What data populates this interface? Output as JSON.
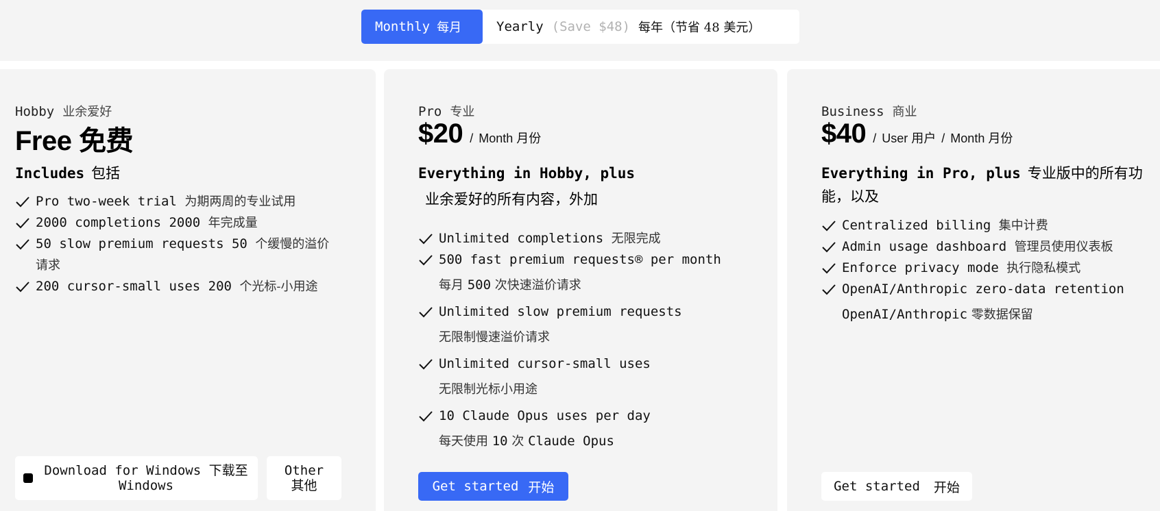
{
  "toggle": {
    "monthly_label": "Monthly",
    "monthly_cn": "每月",
    "yearly_label": "Yearly",
    "yearly_save": "(Save $48)",
    "yearly_cn": "每年（节省 48 美元）"
  },
  "hobby": {
    "name": "Hobby",
    "name_cn": "业余爱好",
    "price": "Free 免费",
    "heading": "Includes",
    "heading_cn": "包括",
    "features": [
      {
        "en": "Pro two-week trial",
        "cn": "为期两周的专业试用"
      },
      {
        "en": "2000 completions 2000",
        "cn": "年完成量"
      },
      {
        "en": "50 slow premium requests 50",
        "cn": "个缓慢的溢价请求"
      },
      {
        "en": "200 cursor-small uses 200",
        "cn": "个光标-小用途"
      }
    ],
    "download_label": "Download for Windows",
    "download_cn": "下载至",
    "download_tail": "Windows",
    "other_label": "Other",
    "other_cn": "其他"
  },
  "pro": {
    "name": "Pro",
    "name_cn": "专业",
    "price": "$20",
    "unit_sep": "/",
    "unit": "Month 月份",
    "heading": "Everything in Hobby, plus",
    "heading_cn": "业余爱好的所有内容，外加",
    "features": [
      {
        "en": "Unlimited completions",
        "cn": "无限完成",
        "sub": ""
      },
      {
        "en": "500 fast premium requests® per month",
        "cn": "",
        "sub_a": "每月",
        "sub_m": "500",
        "sub_b": "次快速溢价请求"
      },
      {
        "en": "Unlimited slow premium requests",
        "cn": "",
        "sub": "无限制慢速溢价请求"
      },
      {
        "en": "Unlimited cursor-small uses",
        "cn": "",
        "sub": "无限制光标小用途"
      },
      {
        "en": "10 Claude Opus uses per day",
        "cn": "",
        "sub_a": "每天使用",
        "sub_m": "10",
        "sub_b": "次",
        "sub_m2": "Claude Opus"
      }
    ],
    "cta": "Get started",
    "cta_cn": "开始"
  },
  "business": {
    "name": "Business",
    "name_cn": "商业",
    "price": "$40",
    "unit_sep": "/",
    "unit_a": "User 用户",
    "unit_b": "Month 月份",
    "heading": "Everything in Pro, plus",
    "heading_cn": "专业版中的所有功能，以及",
    "features": [
      {
        "en": "Centralized billing",
        "cn": "集中计费"
      },
      {
        "en": "Admin usage dashboard",
        "cn": "管理员使用仪表板"
      },
      {
        "en": "Enforce privacy mode",
        "cn": "执行隐私模式"
      },
      {
        "en": "OpenAI/Anthropic zero-data retention",
        "cn": "",
        "sub_m": "OpenAI/Anthropic",
        "sub_b": "零数据保留"
      }
    ],
    "cta": "Get started",
    "cta_cn": "开始"
  },
  "colors": {
    "accent": "#3869f5",
    "card_bg": "#f4f4f4"
  }
}
